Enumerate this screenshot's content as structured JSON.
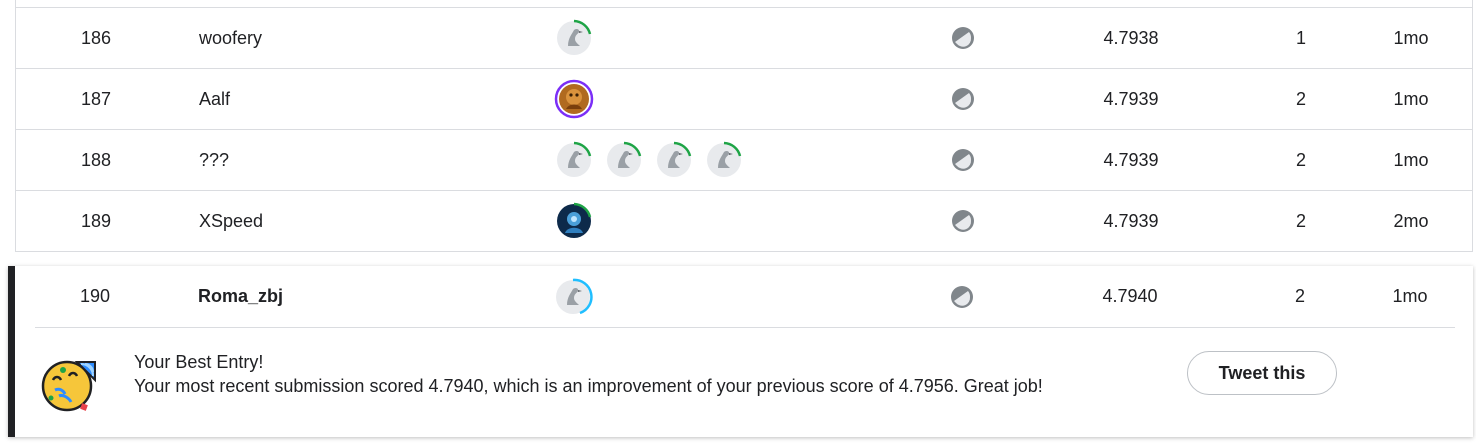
{
  "rows": [
    {
      "rank": "186",
      "team": "woofery",
      "members": [
        "goose"
      ],
      "ring": [
        "#1ea446"
      ],
      "score": "4.7938",
      "entries": "1",
      "last": "1mo"
    },
    {
      "rank": "187",
      "team": "Aalf",
      "members": [
        "photo-brown"
      ],
      "ring": [
        "#7b2ff7"
      ],
      "score": "4.7939",
      "entries": "2",
      "last": "1mo"
    },
    {
      "rank": "188",
      "team": "???",
      "members": [
        "goose",
        "goose",
        "goose",
        "goose"
      ],
      "ring": [
        "#1ea446"
      ],
      "score": "4.7939",
      "entries": "2",
      "last": "1mo"
    },
    {
      "rank": "189",
      "team": "XSpeed",
      "members": [
        "photo-blue"
      ],
      "ring": [
        "#1ea446"
      ],
      "score": "4.7939",
      "entries": "2",
      "last": "2mo"
    }
  ],
  "best_entry": {
    "rank": "190",
    "team": "Roma_zbj",
    "score": "4.7940",
    "entries": "2",
    "last": "1mo",
    "title": "Your Best Entry!",
    "message": "Your most recent submission scored 4.7940, which is an improvement of your previous score of 4.7956. Great job!",
    "tweet_label": "Tweet this"
  },
  "colors": {
    "accent_green": "#1ea446",
    "accent_purple": "#7b2ff7",
    "accent_blue": "#20beff",
    "border": "#dadce0",
    "text": "#202124"
  },
  "icons": {
    "code": "code-compare-icon",
    "avatar_default": "goose-avatar-icon",
    "celebrate": "party-face-icon"
  }
}
